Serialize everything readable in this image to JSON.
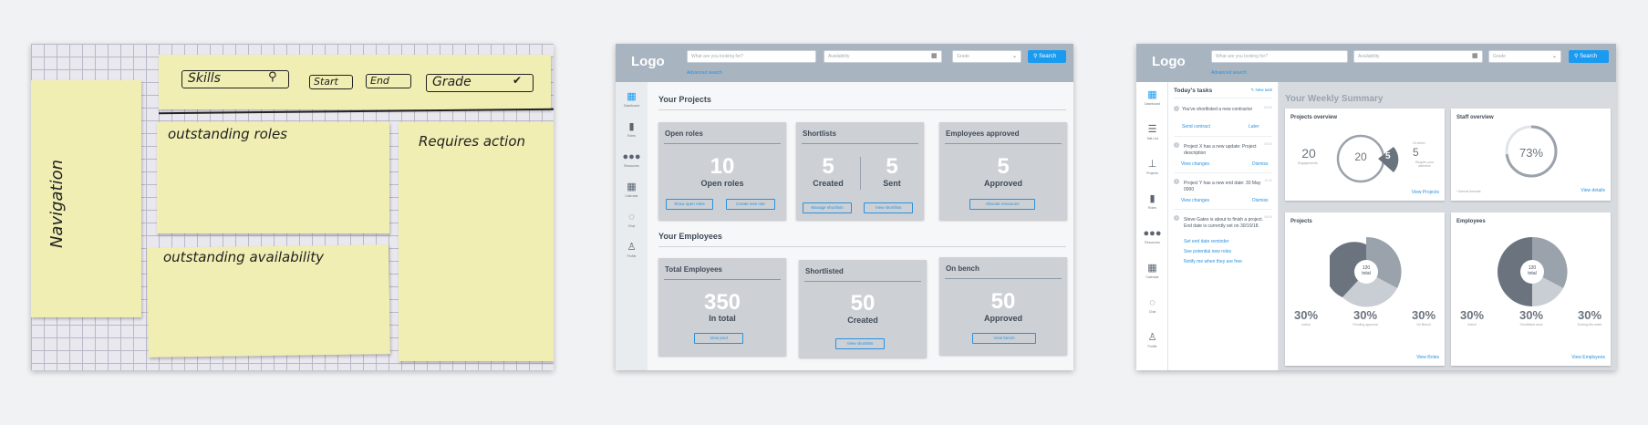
{
  "sketch": {
    "search_label": "Skills",
    "start_label": "Start",
    "end_label": "End",
    "grade_label": "Grade",
    "navigation_label": "Navigation",
    "roles_label": "outstanding roles",
    "action_label": "Requires action",
    "availability_label": "outstanding availability"
  },
  "wireframe1": {
    "logo": "Logo",
    "search_placeholder": "What are you looking for?",
    "availability_placeholder": "Availability",
    "grade_placeholder": "Grade",
    "search_button": "Search",
    "advanced_search": "Advanced search",
    "nav": [
      {
        "label": "Dashboard",
        "icon": "grid-icon"
      },
      {
        "label": "Roles",
        "icon": "document-icon"
      },
      {
        "label": "Resources",
        "icon": "people-icon"
      },
      {
        "label": "Calendar",
        "icon": "calendar-icon"
      },
      {
        "label": "Chat",
        "icon": "chat-icon"
      },
      {
        "label": "Profile",
        "icon": "user-icon"
      }
    ],
    "projects_title": "Your Projects",
    "employees_title": "Your Employees",
    "open_roles": {
      "title": "Open roles",
      "value": "10",
      "sub": "Open roles",
      "btn1": "Show open roles",
      "btn2": "Create new role"
    },
    "shortlists": {
      "title": "Shortlists",
      "value1": "5",
      "sub1": "Created",
      "value2": "5",
      "sub2": "Sent",
      "btn1": "Manage shortlists",
      "btn2": "View shortlists"
    },
    "employees_approved": {
      "title": "Employees approved",
      "value": "5",
      "sub": "Approved",
      "btn": "Allocate resources"
    },
    "total_employees": {
      "title": "Total Employees",
      "value": "350",
      "sub": "In total",
      "btn": "View pool"
    },
    "shortlisted": {
      "title": "Shortlisted",
      "value": "50",
      "sub": "Created",
      "btn": "View shortlists"
    },
    "on_bench": {
      "title": "On bench",
      "value": "50",
      "sub": "Approved",
      "btn": "View bench"
    }
  },
  "wireframe2": {
    "logo": "Logo",
    "search_placeholder": "What are you looking for?",
    "availability_placeholder": "Availability",
    "grade_placeholder": "Grade",
    "search_button": "Search",
    "advanced_search": "Advanced search",
    "nav": [
      {
        "label": "Dashboard",
        "icon": "grid-icon"
      },
      {
        "label": "Talk List",
        "icon": "list-icon"
      },
      {
        "label": "Projects",
        "icon": "org-icon"
      },
      {
        "label": "Roles",
        "icon": "document-icon"
      },
      {
        "label": "Resources",
        "icon": "people-icon"
      },
      {
        "label": "Calendar",
        "icon": "calendar-icon"
      },
      {
        "label": "Chat",
        "icon": "chat-icon"
      },
      {
        "label": "Profile",
        "icon": "user-icon"
      }
    ],
    "tasks_title": "Today's tasks",
    "new_task": "New task",
    "tasks": [
      {
        "num": "1",
        "time": "09:00",
        "text": "You've shortlisted a new contractor",
        "links": [
          "Send contract",
          "Later"
        ]
      },
      {
        "num": "2",
        "time": "09:00",
        "text": "Project X has a new update: Project description",
        "links": [
          "View changes",
          "Dismiss"
        ]
      },
      {
        "num": "3",
        "time": "10:00",
        "text": "Project Y has a new end date: 30 May 0000",
        "links": [
          "View changes",
          "Dismiss"
        ]
      },
      {
        "num": "4",
        "time": "08:00",
        "text": "Steve Gates is about to finish a project. End date is currently set on 30/10/18.",
        "links": [
          "Set end date reminder",
          "See potential new roles",
          "Notify me when they are free"
        ]
      }
    ],
    "summary_title": "Your Weekly Summary",
    "projects_overview": {
      "title": "Projects overview",
      "engagements_value": "20",
      "engagements_label": "Engagements",
      "total_value": "20",
      "slice_value": "5",
      "needs_value": "5",
      "needs_label_top": "Of which",
      "needs_label": "Require your attention",
      "link": "View Projects"
    },
    "staff_overview": {
      "title": "Staff overview",
      "value": "73%",
      "note": "* Annual forecast",
      "link": "View details"
    },
    "projects": {
      "title": "Projects",
      "center_value": "120",
      "center_label": "total",
      "stats": [
        {
          "value": "30%",
          "label": "Active"
        },
        {
          "value": "30%",
          "label": "Pending approval"
        },
        {
          "value": "30%",
          "label": "On Bench"
        }
      ],
      "link": "View Roles"
    },
    "employees": {
      "title": "Employees",
      "center_value": "120",
      "center_label": "total",
      "stats": [
        {
          "value": "30%",
          "label": "Active"
        },
        {
          "value": "30%",
          "label": "Shortlisted work"
        },
        {
          "value": "30%",
          "label": "Ending this week"
        }
      ],
      "link": "View Employees"
    }
  },
  "colors": {
    "accent": "#1a9bf0",
    "topbar": "#a9b4c1",
    "card": "#cdd1d6",
    "sticky": "#f0eeb2"
  }
}
